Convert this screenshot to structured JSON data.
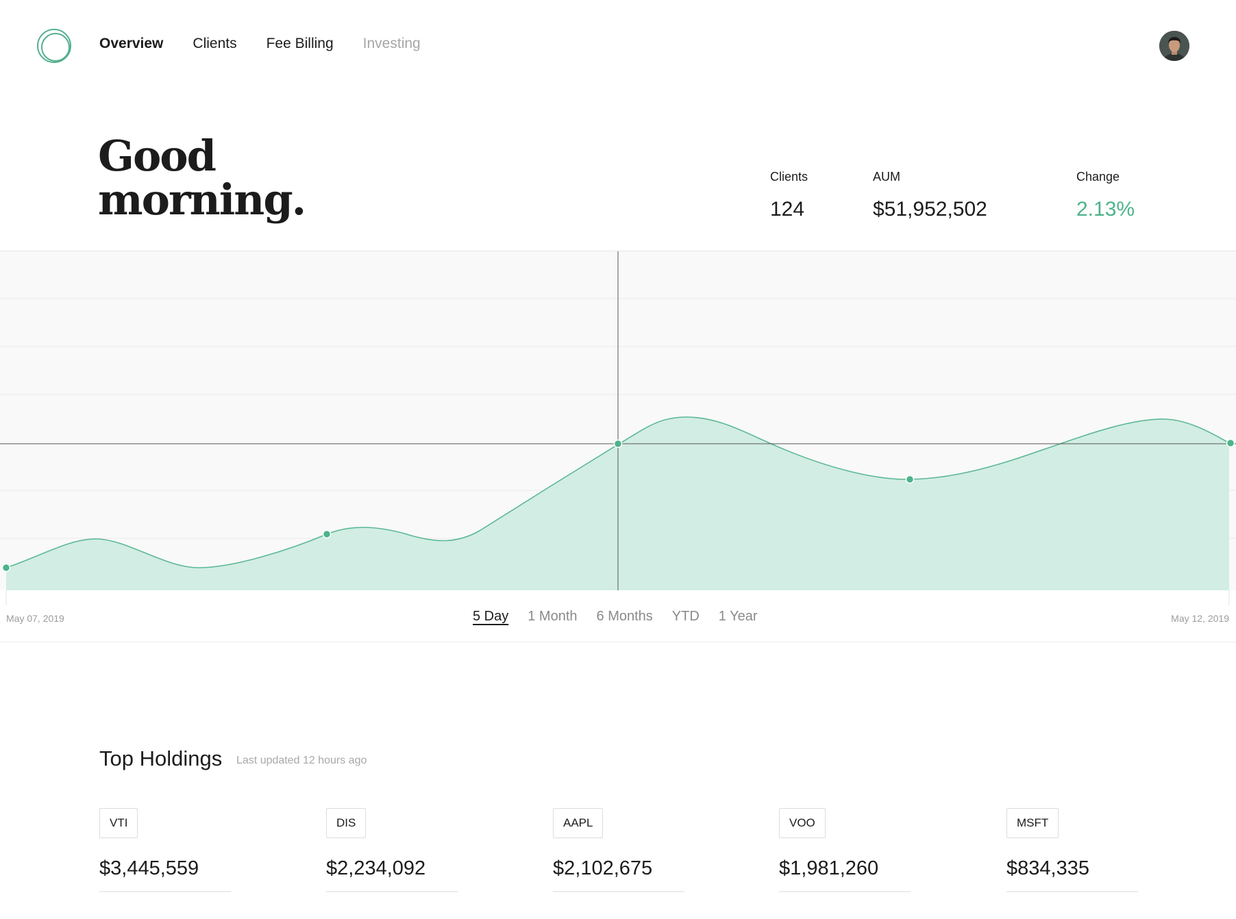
{
  "nav": {
    "links": [
      {
        "label": "Overview"
      },
      {
        "label": "Clients"
      },
      {
        "label": "Fee Billing"
      },
      {
        "label": "Investing"
      }
    ]
  },
  "greeting": {
    "line1": "Good",
    "line2": "morning."
  },
  "stats": {
    "clients": {
      "label": "Clients",
      "value": "124"
    },
    "aum": {
      "label": "AUM",
      "value": "$51,952,502"
    },
    "change": {
      "label": "Change",
      "value": "2.13%"
    }
  },
  "chart": {
    "start_date": "May 07, 2019",
    "end_date": "May 12, 2019",
    "ranges": [
      "5 Day",
      "1 Month",
      "6 Months",
      "YTD",
      "1 Year"
    ],
    "active_range": "5 Day"
  },
  "holdings": {
    "title": "Top Holdings",
    "subtitle": "Last updated 12 hours ago",
    "items": [
      {
        "ticker": "VTI",
        "value": "$3,445,559"
      },
      {
        "ticker": "DIS",
        "value": "$2,234,092"
      },
      {
        "ticker": "AAPL",
        "value": "$2,102,675"
      },
      {
        "ticker": "VOO",
        "value": "$1,981,260"
      },
      {
        "ticker": "MSFT",
        "value": "$834,335"
      }
    ]
  },
  "colors": {
    "accent": "#4cb38a",
    "fill": "#d2ede3",
    "chart_bg": "#f9f9f9"
  }
}
